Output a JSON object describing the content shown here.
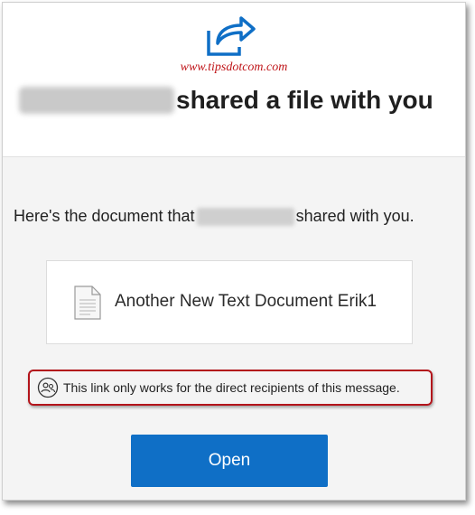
{
  "header": {
    "watermark": "www.tipsdotcom.com",
    "title_suffix": "shared a file with you"
  },
  "body": {
    "intro_prefix": "Here's the document that",
    "intro_suffix": "shared with you."
  },
  "document": {
    "name": "Another New Text Document Erik1",
    "icon": "text-file-icon"
  },
  "notice": {
    "icon": "people-icon",
    "text": "This link only works for the direct recipients of this message."
  },
  "actions": {
    "open_label": "Open"
  },
  "colors": {
    "accent": "#0f6fc6",
    "highlight_border": "#b3141b",
    "watermark": "#c0171b",
    "background": "#f4f4f4"
  }
}
